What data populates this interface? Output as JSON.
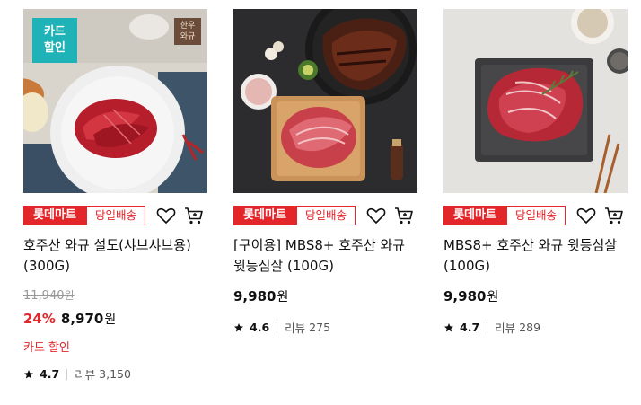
{
  "products": [
    {
      "card_badge": "카드\n할인",
      "corner_logo": "한우\n와규",
      "tag_mart": "롯데마트",
      "tag_same_day": "당일배송",
      "title": "호주산 와규 설도(샤브샤브용) (300G)",
      "original_price": "11,940",
      "original_unit": "원",
      "discount": "24%",
      "price": "8,970",
      "unit": "원",
      "card_sale": "카드 할인",
      "rating": "4.7",
      "review_label": "리뷰",
      "review_count": "3,150"
    },
    {
      "tag_mart": "롯데마트",
      "tag_same_day": "당일배송",
      "title": "[구이용] MBS8+ 호주산 와규 윗등심살 (100G)",
      "price": "9,980",
      "unit": "원",
      "rating": "4.6",
      "review_label": "리뷰",
      "review_count": "275"
    },
    {
      "tag_mart": "롯데마트",
      "tag_same_day": "당일배송",
      "title": "MBS8+ 호주산 와규 윗등심살 (100G)",
      "price": "9,980",
      "unit": "원",
      "rating": "4.7",
      "review_label": "리뷰",
      "review_count": "289"
    }
  ],
  "colors": {
    "accent": "#e3262a",
    "badge_teal": "#1fb3b8"
  },
  "icons": [
    "heart-icon",
    "cart-icon",
    "star-icon"
  ]
}
